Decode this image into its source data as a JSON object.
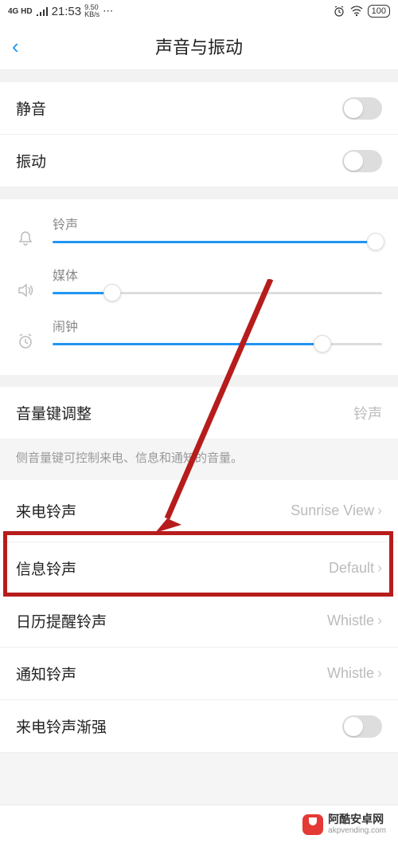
{
  "status": {
    "network": "4G HD",
    "time": "21:53",
    "speed_top": "9.50",
    "speed_bottom": "KB/s",
    "dots": "⋯",
    "battery": "100"
  },
  "header": {
    "title": "声音与振动",
    "back": "‹"
  },
  "toggles": {
    "mute_label": "静音",
    "vibrate_label": "振动"
  },
  "sliders": {
    "ringtone": {
      "label": "铃声",
      "value": 98
    },
    "media": {
      "label": "媒体",
      "value": 18
    },
    "alarm": {
      "label": "闹钟",
      "value": 82
    }
  },
  "volume_key": {
    "label": "音量键调整",
    "value": "铃声",
    "hint": "侧音量键可控制来电、信息和通知的音量。"
  },
  "ringtones": {
    "incoming": {
      "label": "来电铃声",
      "value": "Sunrise View"
    },
    "message": {
      "label": "信息铃声",
      "value": "Default"
    },
    "calendar": {
      "label": "日历提醒铃声",
      "value": "Whistle"
    },
    "notification": {
      "label": "通知铃声",
      "value": "Whistle"
    },
    "ascending": {
      "label": "来电铃声渐强"
    }
  },
  "footer": {
    "name": "阿酷安卓网",
    "url": "akpvending.com"
  },
  "icons": {
    "alarm": "⏰",
    "wifi": "📶",
    "bell": "🔔",
    "speaker": "🔊",
    "clock": "⏱"
  }
}
